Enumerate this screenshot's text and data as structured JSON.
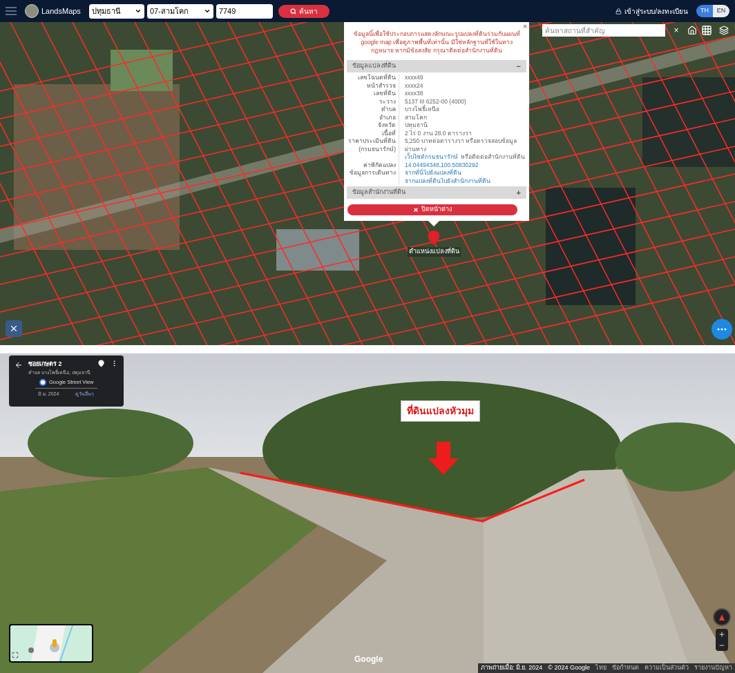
{
  "header": {
    "brand": "LandsMaps",
    "province": "ปทุมธานี",
    "district": "07-สามโคก",
    "parcel_number": "7749",
    "search_button": "ค้นหา",
    "login": "เข้าสู่ระบบ/ลงทะเบียน",
    "languages": [
      {
        "label": "TH",
        "selected": true
      },
      {
        "label": "EN",
        "selected": false
      }
    ]
  },
  "map": {
    "search_placeholder": "ค้นหาสถานที่สำคัญ",
    "clear_button": "×",
    "marker_label": "ตำแหน่งแปลงที่ดิน",
    "popup": {
      "notice": "ข้อมูลนี้เพื่อใช้ประกอบการแสดงลักษณะรูปแปลงที่ดินร่วมกับแผนที่ google map เพื่อดูภาพพื้นที่เท่านั้น มิใช่หลักฐานที่ใช้ในทางกฎหมาย หากมีข้อสงสัย กรุณาติดต่อสำนักงานที่ดิน",
      "close_x": "×",
      "sections": [
        {
          "title": "ข้อมูลแปลงที่ดิน",
          "toggle": "−",
          "expanded": true,
          "rows": [
            {
              "label": [
                "เลขโฉนดที่ดิน"
              ],
              "value": [
                {
                  "kind": "text",
                  "text": "xxxx49"
                }
              ]
            },
            {
              "label": [
                "หน้าสำรวจ"
              ],
              "value": [
                {
                  "kind": "text",
                  "text": "xxxx24"
                }
              ]
            },
            {
              "label": [
                "เลขที่ดิน"
              ],
              "value": [
                {
                  "kind": "text",
                  "text": "xxxx38"
                }
              ]
            },
            {
              "label": [
                "ระวาง"
              ],
              "value": [
                {
                  "kind": "text",
                  "text": "5137 III 6252-00 (4000)"
                }
              ]
            },
            {
              "label": [
                "ตำบล"
              ],
              "value": [
                {
                  "kind": "text",
                  "text": "บางโพธิ์เหนือ"
                }
              ]
            },
            {
              "label": [
                "อำเภอ"
              ],
              "value": [
                {
                  "kind": "text",
                  "text": "สามโคก"
                }
              ]
            },
            {
              "label": [
                "จังหวัด"
              ],
              "value": [
                {
                  "kind": "text",
                  "text": "ปทุมธานี"
                }
              ]
            },
            {
              "label": [
                "เนื้อที่"
              ],
              "value": [
                {
                  "kind": "text",
                  "text": "2 ไร่ 0 งาน 28.0 ตารางวา"
                }
              ]
            },
            {
              "label": [
                "ราคาประเมินที่ดิน",
                "(กรมธนารักษ์)"
              ],
              "value": [
                {
                  "kind": "text",
                  "text": "5,250 บาทต่อตารางวา หรือตรวจสอบข้อมูลผ่านทาง"
                },
                {
                  "kind": "link",
                  "text": "เว็บไซต์กรมธนารักษ์"
                },
                {
                  "kind": "text",
                  "text": "หรือติดต่อสำนักงานที่ดิน"
                }
              ]
            },
            {
              "label": [
                "ค่าพิกัดแปลง"
              ],
              "value": [
                {
                  "kind": "link",
                  "text": "14.04494348,100.50830292"
                }
              ]
            },
            {
              "label": [
                "ข้อมูลการเดินทาง"
              ],
              "value": [
                {
                  "kind": "link",
                  "text": "จากที่นี่ไปยังแปลงที่ดิน"
                },
                {
                  "kind": "link",
                  "text": "จากแปลงที่ดินไปยังสำนักงานที่ดิน"
                }
              ]
            }
          ]
        },
        {
          "title": "ข้อมูลสำนักงานที่ดิน",
          "toggle": "+",
          "expanded": false
        }
      ],
      "close_button": "ปิดหน้าต่าง"
    }
  },
  "street_view": {
    "title": "ซอยเกษตร 2",
    "subtitle": "ตำบล บางโพธิ์เหนือ, ปทุมธานี",
    "source": "Google Street View",
    "date": "มิ.ย. 2024",
    "other_dates": "ดูวันอื่นๆ",
    "annotation": "ที่ดินแปลงหัวมุม",
    "logo": "Google",
    "footer": [
      "ภาพถ่ายเมื่อ: มิ.ย. 2024",
      "© 2024 Google",
      "ไทย",
      "ข้อกำหนด",
      "ความเป็นส่วนตัว",
      "รายงานปัญหา"
    ]
  }
}
